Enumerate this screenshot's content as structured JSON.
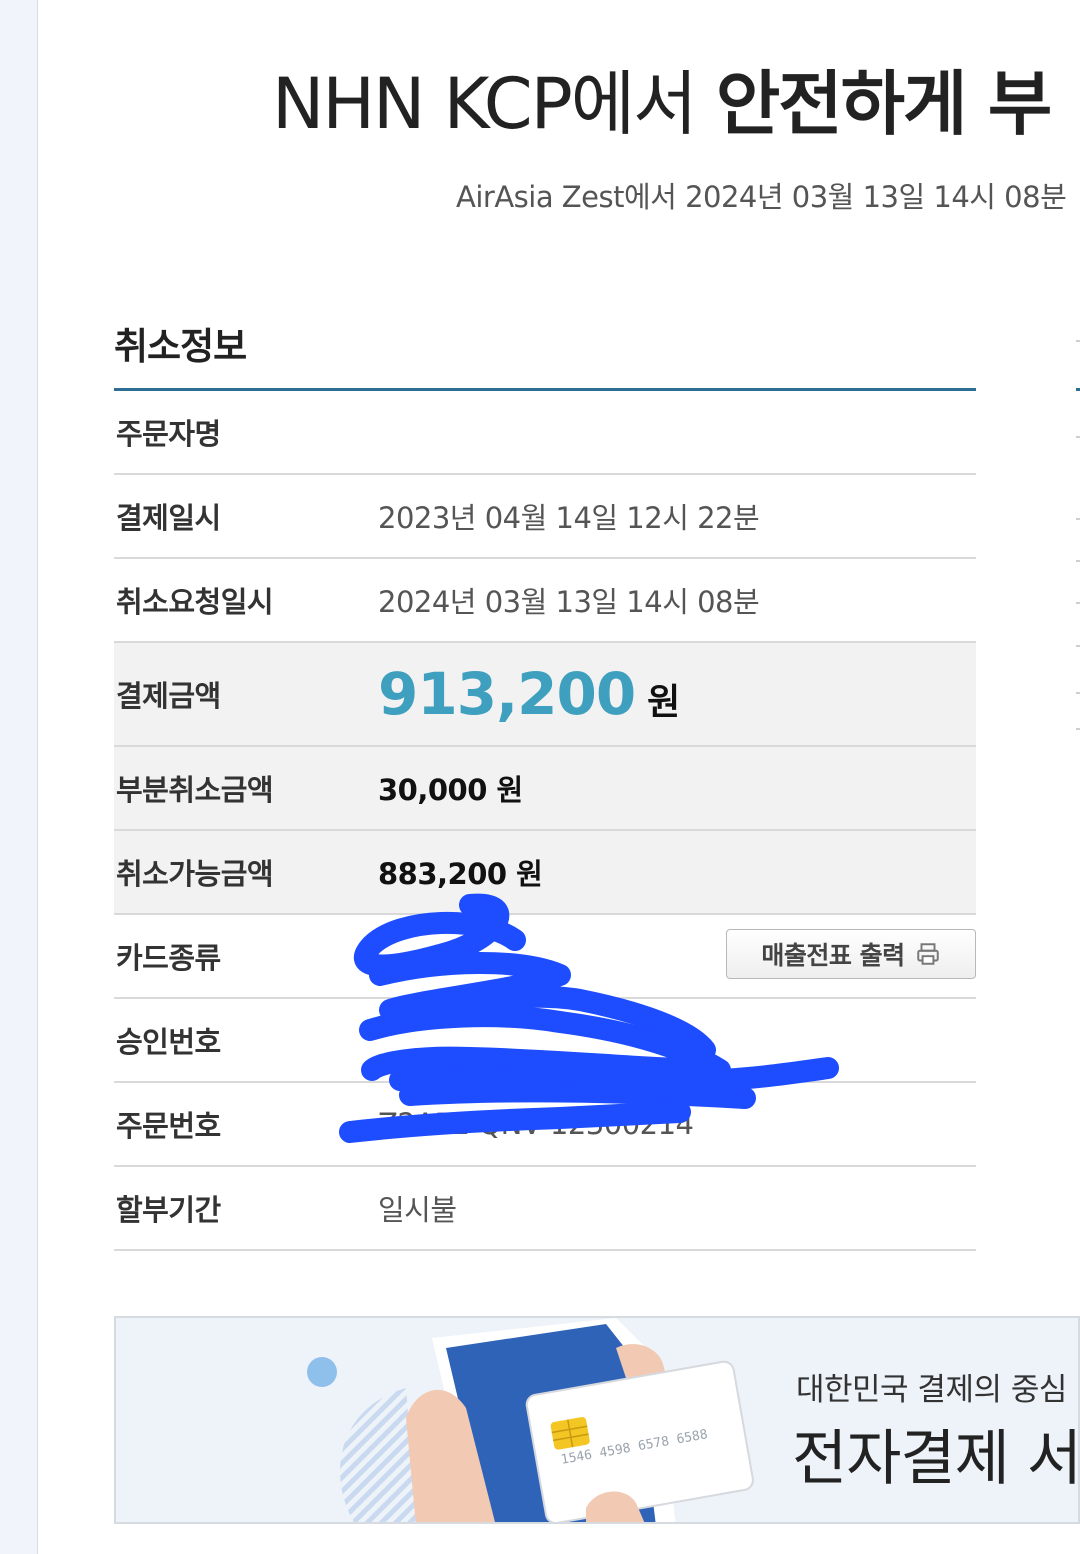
{
  "header": {
    "title_light": "NHN KCP에서 ",
    "title_bold": "안전하게 부",
    "subtitle": "AirAsia Zest에서 2024년 03월 13일 14시 08분"
  },
  "cancel_info": {
    "section_title": "취소정보",
    "rows": {
      "orderer_name": {
        "label": "주문자명",
        "value": ""
      },
      "payment_date": {
        "label": "결제일시",
        "value": "2023년 04월 14일 12시 22분"
      },
      "cancel_request_date": {
        "label": "취소요청일시",
        "value": "2024년 03월 13일 14시 08분"
      },
      "payment_amount": {
        "label": "결제금액",
        "value": "913,200",
        "unit": "원"
      },
      "partial_cancel_amount": {
        "label": "부분취소금액",
        "value": "30,000 원"
      },
      "cancelable_amount": {
        "label": "취소가능금액",
        "value": "883,200 원"
      },
      "card_type": {
        "label": "카드종류",
        "button": "매출전표 출력"
      },
      "approval_number": {
        "label": "승인번호"
      },
      "order_number": {
        "label": "주문번호",
        "value": "Z2AP2 QNV 12300214"
      },
      "installment": {
        "label": "할부기간",
        "value": "일시불"
      }
    }
  },
  "banner": {
    "subtitle": "대한민국 결제의 중심",
    "title": "전자결제 서",
    "card_number": "1546 4598 6578 6588"
  },
  "colors": {
    "accent": "#3f9fbe",
    "rule": "#2e6e95",
    "redaction": "#1d4dff"
  }
}
